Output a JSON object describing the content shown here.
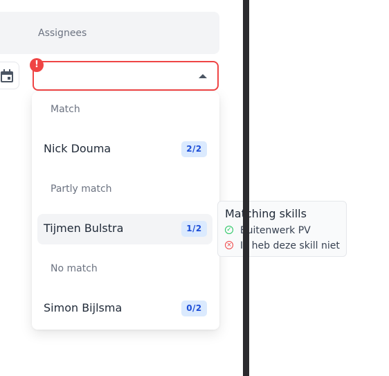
{
  "header": {
    "label": "Assignees"
  },
  "icons": {
    "calendar": "calendar-icon",
    "caret": "caret-up-icon",
    "error": "error-icon",
    "check": "check-circle-icon",
    "cross": "x-circle-icon"
  },
  "error_badge": "!",
  "colors": {
    "error": "#ef4444",
    "badge_bg": "#dbeafe",
    "badge_text": "#1d4ed8",
    "success": "#22c55e"
  },
  "dropdown": {
    "groups": [
      {
        "label": "Match",
        "options": [
          {
            "name": "Nick Douma",
            "count": "2/2"
          }
        ]
      },
      {
        "label": "Partly match",
        "options": [
          {
            "name": "Tijmen Bulstra",
            "count": "1/2"
          }
        ]
      },
      {
        "label": "No match",
        "options": [
          {
            "name": "Simon Bijlsma",
            "count": "0/2"
          }
        ]
      }
    ]
  },
  "tooltip": {
    "title": "Matching skills",
    "skills": [
      {
        "name": "Buitenwerk PV",
        "status": "match"
      },
      {
        "name": "Ik heb deze skill niet",
        "status": "no-match"
      }
    ]
  }
}
